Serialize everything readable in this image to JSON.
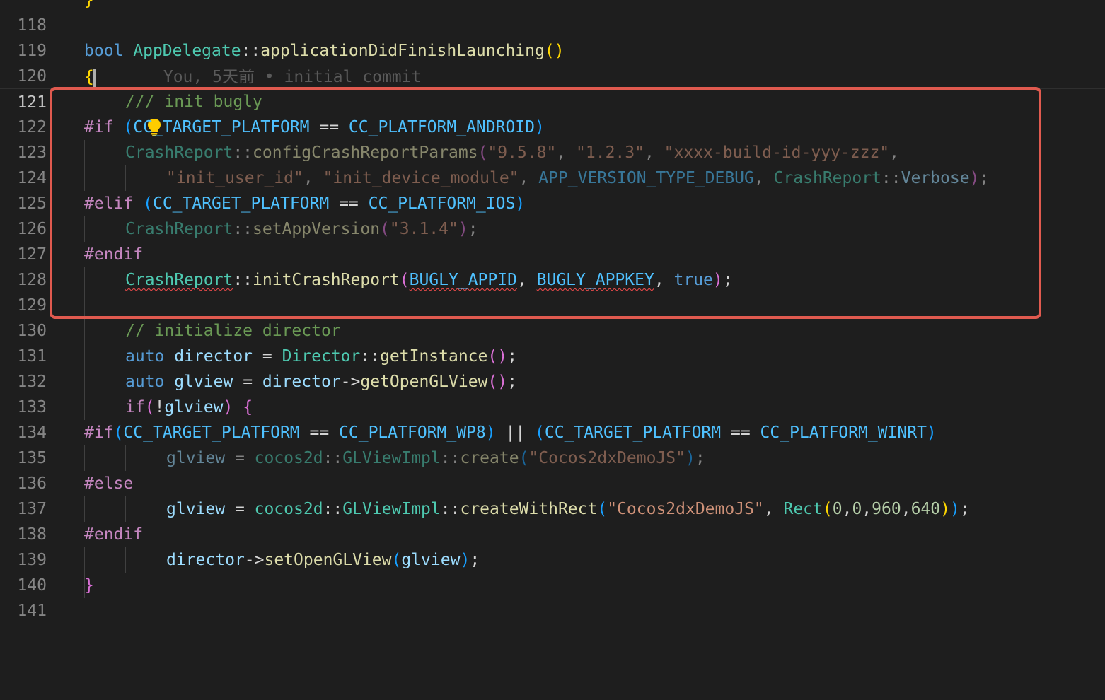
{
  "lines": [
    {
      "num": "118",
      "code": "}"
    },
    {
      "num": "119",
      "code": ""
    },
    {
      "num": "120",
      "code": "bool AppDelegate::applicationDidFinishLaunching()"
    },
    {
      "num": "121",
      "code": "{"
    },
    {
      "num": "122",
      "code": "/// init bugly"
    },
    {
      "num": "123",
      "code": "#if (CC_TARGET_PLATFORM == CC_PLATFORM_ANDROID)"
    },
    {
      "num": "124",
      "code": "CrashReport::configCrashReportParams(\"9.5.8\", \"1.2.3\", \"xxxx-build-id-yyy-zzz\","
    },
    {
      "num": "125",
      "code": "\"init_user_id\", \"init_device_module\", APP_VERSION_TYPE_DEBUG, CrashReport::Verbose);"
    },
    {
      "num": "126",
      "code": "#elif (CC_TARGET_PLATFORM == CC_PLATFORM_IOS)"
    },
    {
      "num": "127",
      "code": "CrashReport::setAppVersion(\"3.1.4\");"
    },
    {
      "num": "128",
      "code": "#endif"
    },
    {
      "num": "129",
      "code": "CrashReport::initCrashReport(BUGLY_APPID, BUGLY_APPKEY, true);"
    },
    {
      "num": "130",
      "code": ""
    },
    {
      "num": "131",
      "code": "// initialize director"
    },
    {
      "num": "132",
      "code": "auto director = Director::getInstance();"
    },
    {
      "num": "133",
      "code": "auto glview = director->getOpenGLView();"
    },
    {
      "num": "134",
      "code": "if(!glview) {"
    },
    {
      "num": "135",
      "code": "#if(CC_TARGET_PLATFORM == CC_PLATFORM_WP8) || (CC_TARGET_PLATFORM == CC_PLATFORM_WINRT)"
    },
    {
      "num": "136",
      "code": "glview = cocos2d::GLViewImpl::create(\"Cocos2dxDemoJS\");"
    },
    {
      "num": "137",
      "code": "#else"
    },
    {
      "num": "138",
      "code": "glview = cocos2d::GLViewImpl::createWithRect(\"Cocos2dxDemoJS\", Rect(0,0,960,640));"
    },
    {
      "num": "139",
      "code": "#endif"
    },
    {
      "num": "140",
      "code": "director->setOpenGLView(glview);"
    },
    {
      "num": "141",
      "code": "}"
    }
  ],
  "blame": "You, 5天前 • initial commit",
  "icons": {
    "lightbulb": "lightbulb-icon"
  },
  "colors": {
    "background": "#1e1e1e",
    "highlight_border": "#e05a4f",
    "error_squiggle": "#f14c4c"
  }
}
